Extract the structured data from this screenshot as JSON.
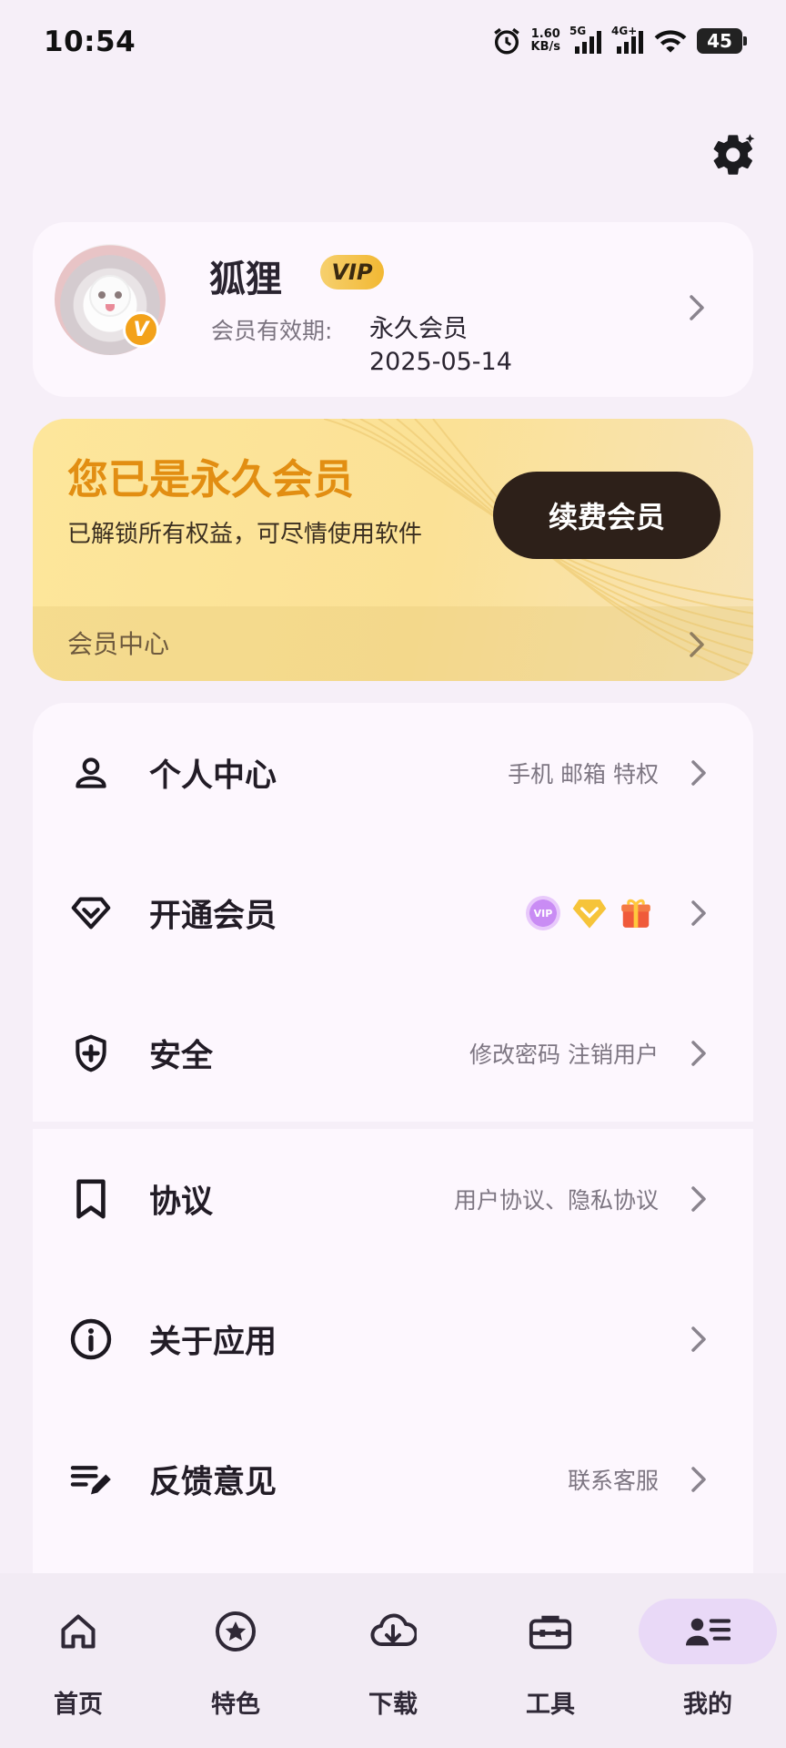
{
  "status_bar": {
    "time": "10:54",
    "net_speed_value": "1.60",
    "net_speed_unit": "KB/s",
    "net1_label": "5G",
    "net2_label": "4G+",
    "battery": "45"
  },
  "profile": {
    "username": "狐狸",
    "vip_tag": "VIP",
    "avatar_badge": "V",
    "expiry_label": "会员有效期:",
    "expiry_type": "永久会员",
    "expiry_date": "2025-05-14"
  },
  "vip_banner": {
    "title": "您已是永久会员",
    "subtitle": "已解锁所有权益，可尽情使用软件",
    "renew_button": "续费会员",
    "center_label": "会员中心"
  },
  "menu": {
    "personal": {
      "label": "个人中心",
      "hint": "手机 邮箱 特权",
      "icon": "person-icon"
    },
    "membership": {
      "label": "开通会员",
      "icon": "diamond-icon",
      "badge_vip": "VIP"
    },
    "security": {
      "label": "安全",
      "hint": "修改密码  注销用户",
      "icon": "shield-icon"
    },
    "agreement": {
      "label": "协议",
      "hint": "用户协议、隐私协议",
      "icon": "bookmark-icon"
    },
    "about": {
      "label": "关于应用",
      "icon": "info-icon"
    },
    "feedback": {
      "label": "反馈意见",
      "hint": "联系客服",
      "icon": "edit-list-icon"
    }
  },
  "bottom_nav": {
    "home": "首页",
    "featured": "特色",
    "download": "下载",
    "tools": "工具",
    "mine": "我的",
    "active": "mine"
  },
  "colors": {
    "background": "#f6eff8",
    "card": "#fdf7fe",
    "vip_gold": "#e28e12",
    "banner": "#fde69b",
    "renew_button": "#2d2019",
    "active_nav": "#e9d9f7"
  }
}
